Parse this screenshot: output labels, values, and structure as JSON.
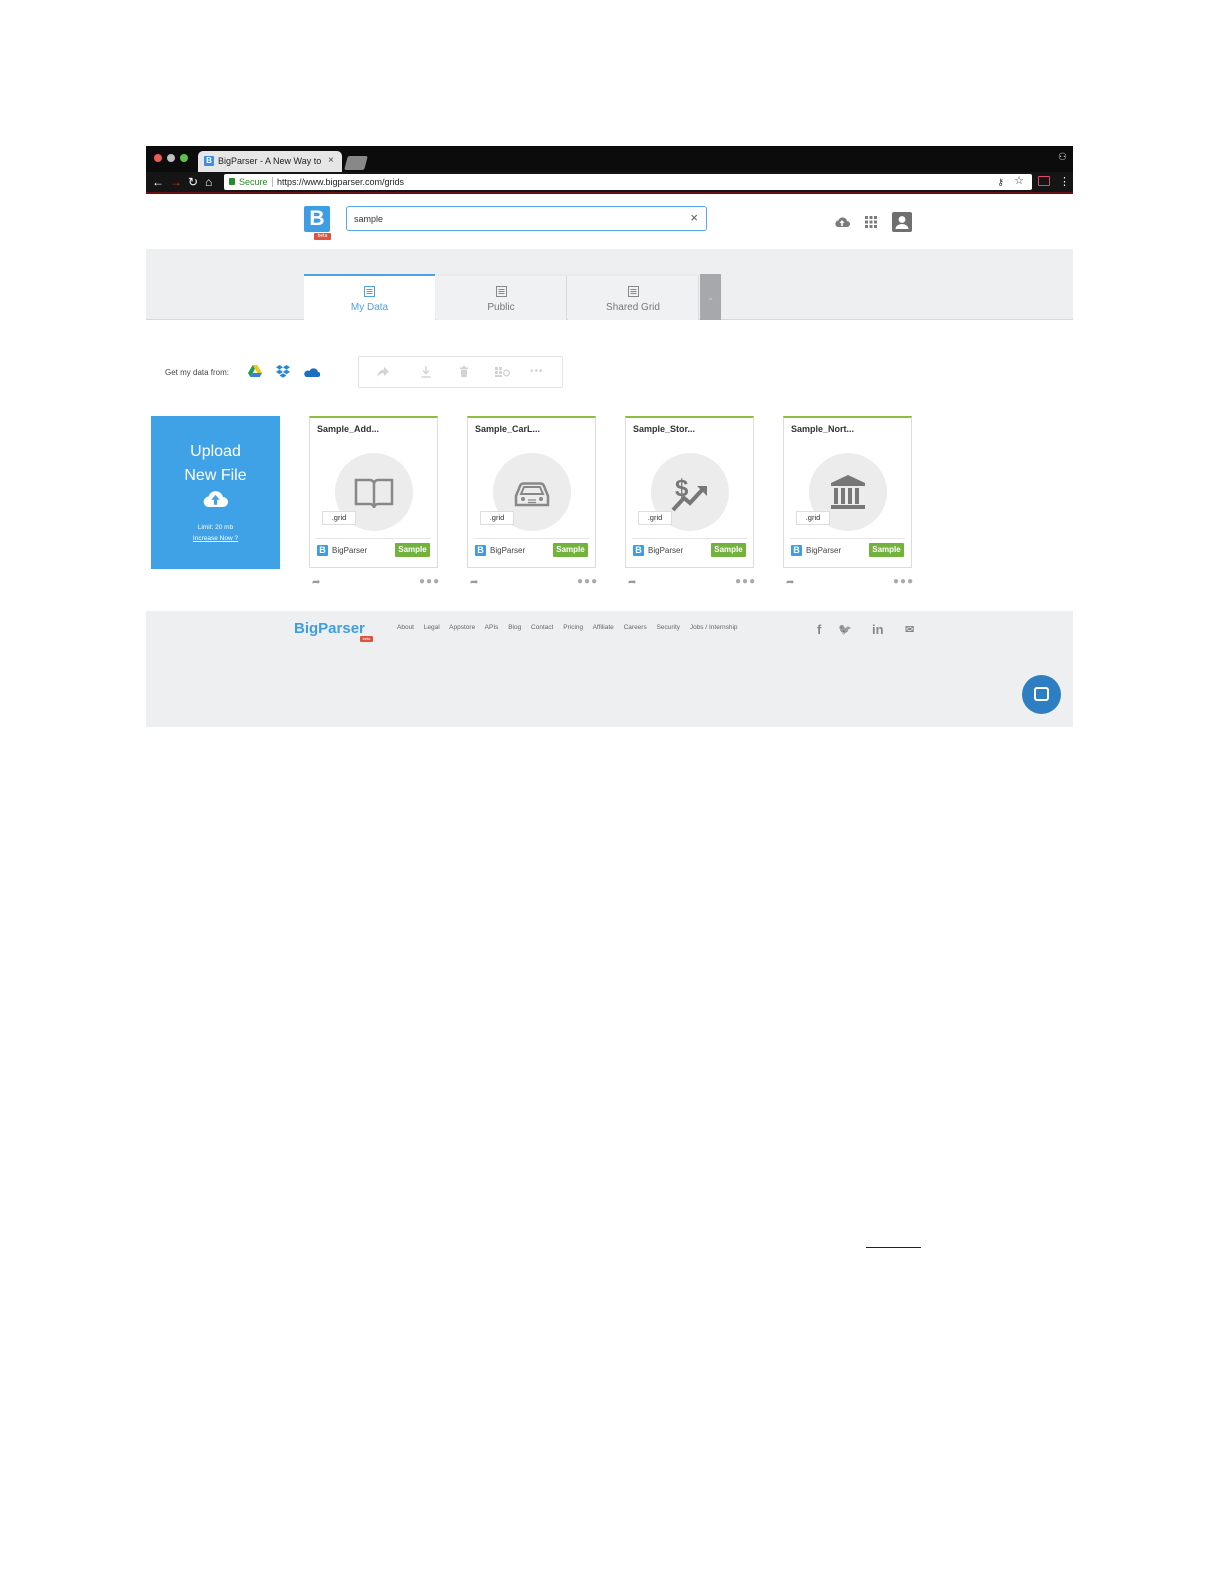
{
  "browser": {
    "tab_title": "BigParser - A New Way to Sea",
    "tab_favicon": "B",
    "close_glyph": "×",
    "secure_label": "Secure",
    "url": "https://www.bigparser.com/grids"
  },
  "header": {
    "logo_letter": "B",
    "logo_badge": "beta",
    "search_value": "sample"
  },
  "tabs": [
    {
      "label": "My Data"
    },
    {
      "label": "Public"
    },
    {
      "label": "Shared Grid"
    }
  ],
  "sources": {
    "label": "Get my data from:",
    "icons": [
      "google-drive-icon",
      "dropbox-icon",
      "onedrive-icon"
    ]
  },
  "actions": [
    "share-icon",
    "download-icon",
    "trash-icon",
    "move-icon",
    "more-icon"
  ],
  "upload": {
    "title_line1": "Upload",
    "title_line2": "New File",
    "limit": "Limit: 20 mb",
    "increase": "Increase Now ?"
  },
  "cards": [
    {
      "title": "Sample_Add...",
      "icon": "book-icon",
      "tag": ".grid",
      "owner": "BigParser",
      "badge": "Sample"
    },
    {
      "title": "Sample_CarL...",
      "icon": "car-icon",
      "tag": ".grid",
      "owner": "BigParser",
      "badge": "Sample"
    },
    {
      "title": "Sample_Stor...",
      "icon": "dollar-chart-icon",
      "tag": ".grid",
      "owner": "BigParser",
      "badge": "Sample"
    },
    {
      "title": "Sample_Nort...",
      "icon": "bank-icon",
      "tag": ".grid",
      "owner": "BigParser",
      "badge": "Sample"
    }
  ],
  "footer": {
    "logo": "BigParser",
    "logo_badge": "beta",
    "links": [
      "About",
      "Legal",
      "Appstore",
      "APIs",
      "Blog",
      "Contact",
      "Pricing",
      "Affiliate",
      "Careers",
      "Security",
      "Jobs / Internship"
    ],
    "social": {
      "facebook": "f",
      "twitter": "🐦",
      "linkedin": "in",
      "mail": "✉"
    }
  },
  "colors": {
    "accent": "#3f9de3",
    "card_top": "#8cbf3f",
    "sample_badge": "#73b33d",
    "beta_badge": "#e0533d",
    "chat": "#2e7fc1"
  }
}
